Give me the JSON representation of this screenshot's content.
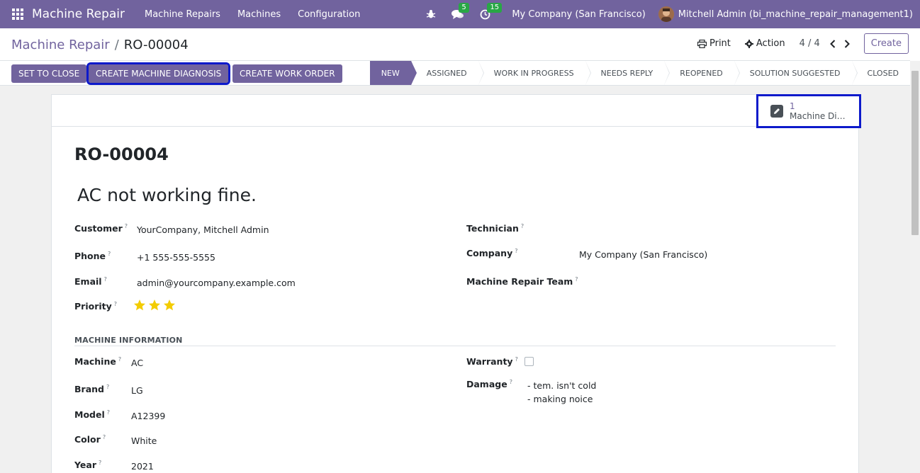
{
  "navbar": {
    "brand": "Machine Repair",
    "menus": [
      "Machine Repairs",
      "Machines",
      "Configuration"
    ],
    "chat_count": "5",
    "activity_count": "15",
    "company": "My Company (San Francisco)",
    "user": "Mitchell Admin (bi_machine_repair_management1)",
    "colors": {
      "primary": "#71639e",
      "badge": "#28a745"
    }
  },
  "breadcrumb": {
    "parent": "Machine Repair",
    "current": "RO-00004"
  },
  "actions": {
    "print": "Print",
    "action": "Action",
    "pager": "4 / 4",
    "create": "Create"
  },
  "statusbar": {
    "buttons": [
      "SET TO CLOSE",
      "CREATE MACHINE DIAGNOSIS",
      "CREATE WORK ORDER"
    ],
    "stages": [
      "NEW",
      "ASSIGNED",
      "WORK IN PROGRESS",
      "NEEDS REPLY",
      "REOPENED",
      "SOLUTION SUGGESTED",
      "CLOSED"
    ],
    "active_stage": "NEW"
  },
  "smart_button": {
    "count": "1",
    "label": "Machine Di…"
  },
  "record": {
    "reference": "RO-00004",
    "title": "AC not working fine.",
    "customer_label": "Customer",
    "customer": "YourCompany, Mitchell Admin",
    "phone_label": "Phone",
    "phone": "+1 555-555-5555",
    "email_label": "Email",
    "email": "admin@yourcompany.example.com",
    "priority_label": "Priority",
    "priority_stars": 3,
    "technician_label": "Technician",
    "technician": "",
    "company_label": "Company",
    "company": "My Company (San Francisco)",
    "team_label": "Machine Repair Team",
    "team": ""
  },
  "machine_info": {
    "section_title": "MACHINE INFORMATION",
    "machine_label": "Machine",
    "machine": "AC",
    "brand_label": "Brand",
    "brand": "LG",
    "model_label": "Model",
    "model": "A12399",
    "color_label": "Color",
    "color": "White",
    "year_label": "Year",
    "year": "2021",
    "warranty_label": "Warranty",
    "warranty": false,
    "damage_label": "Damage",
    "damage_lines": [
      "- tem. isn't cold",
      "- making noice"
    ]
  },
  "tooltip_marker": "?"
}
